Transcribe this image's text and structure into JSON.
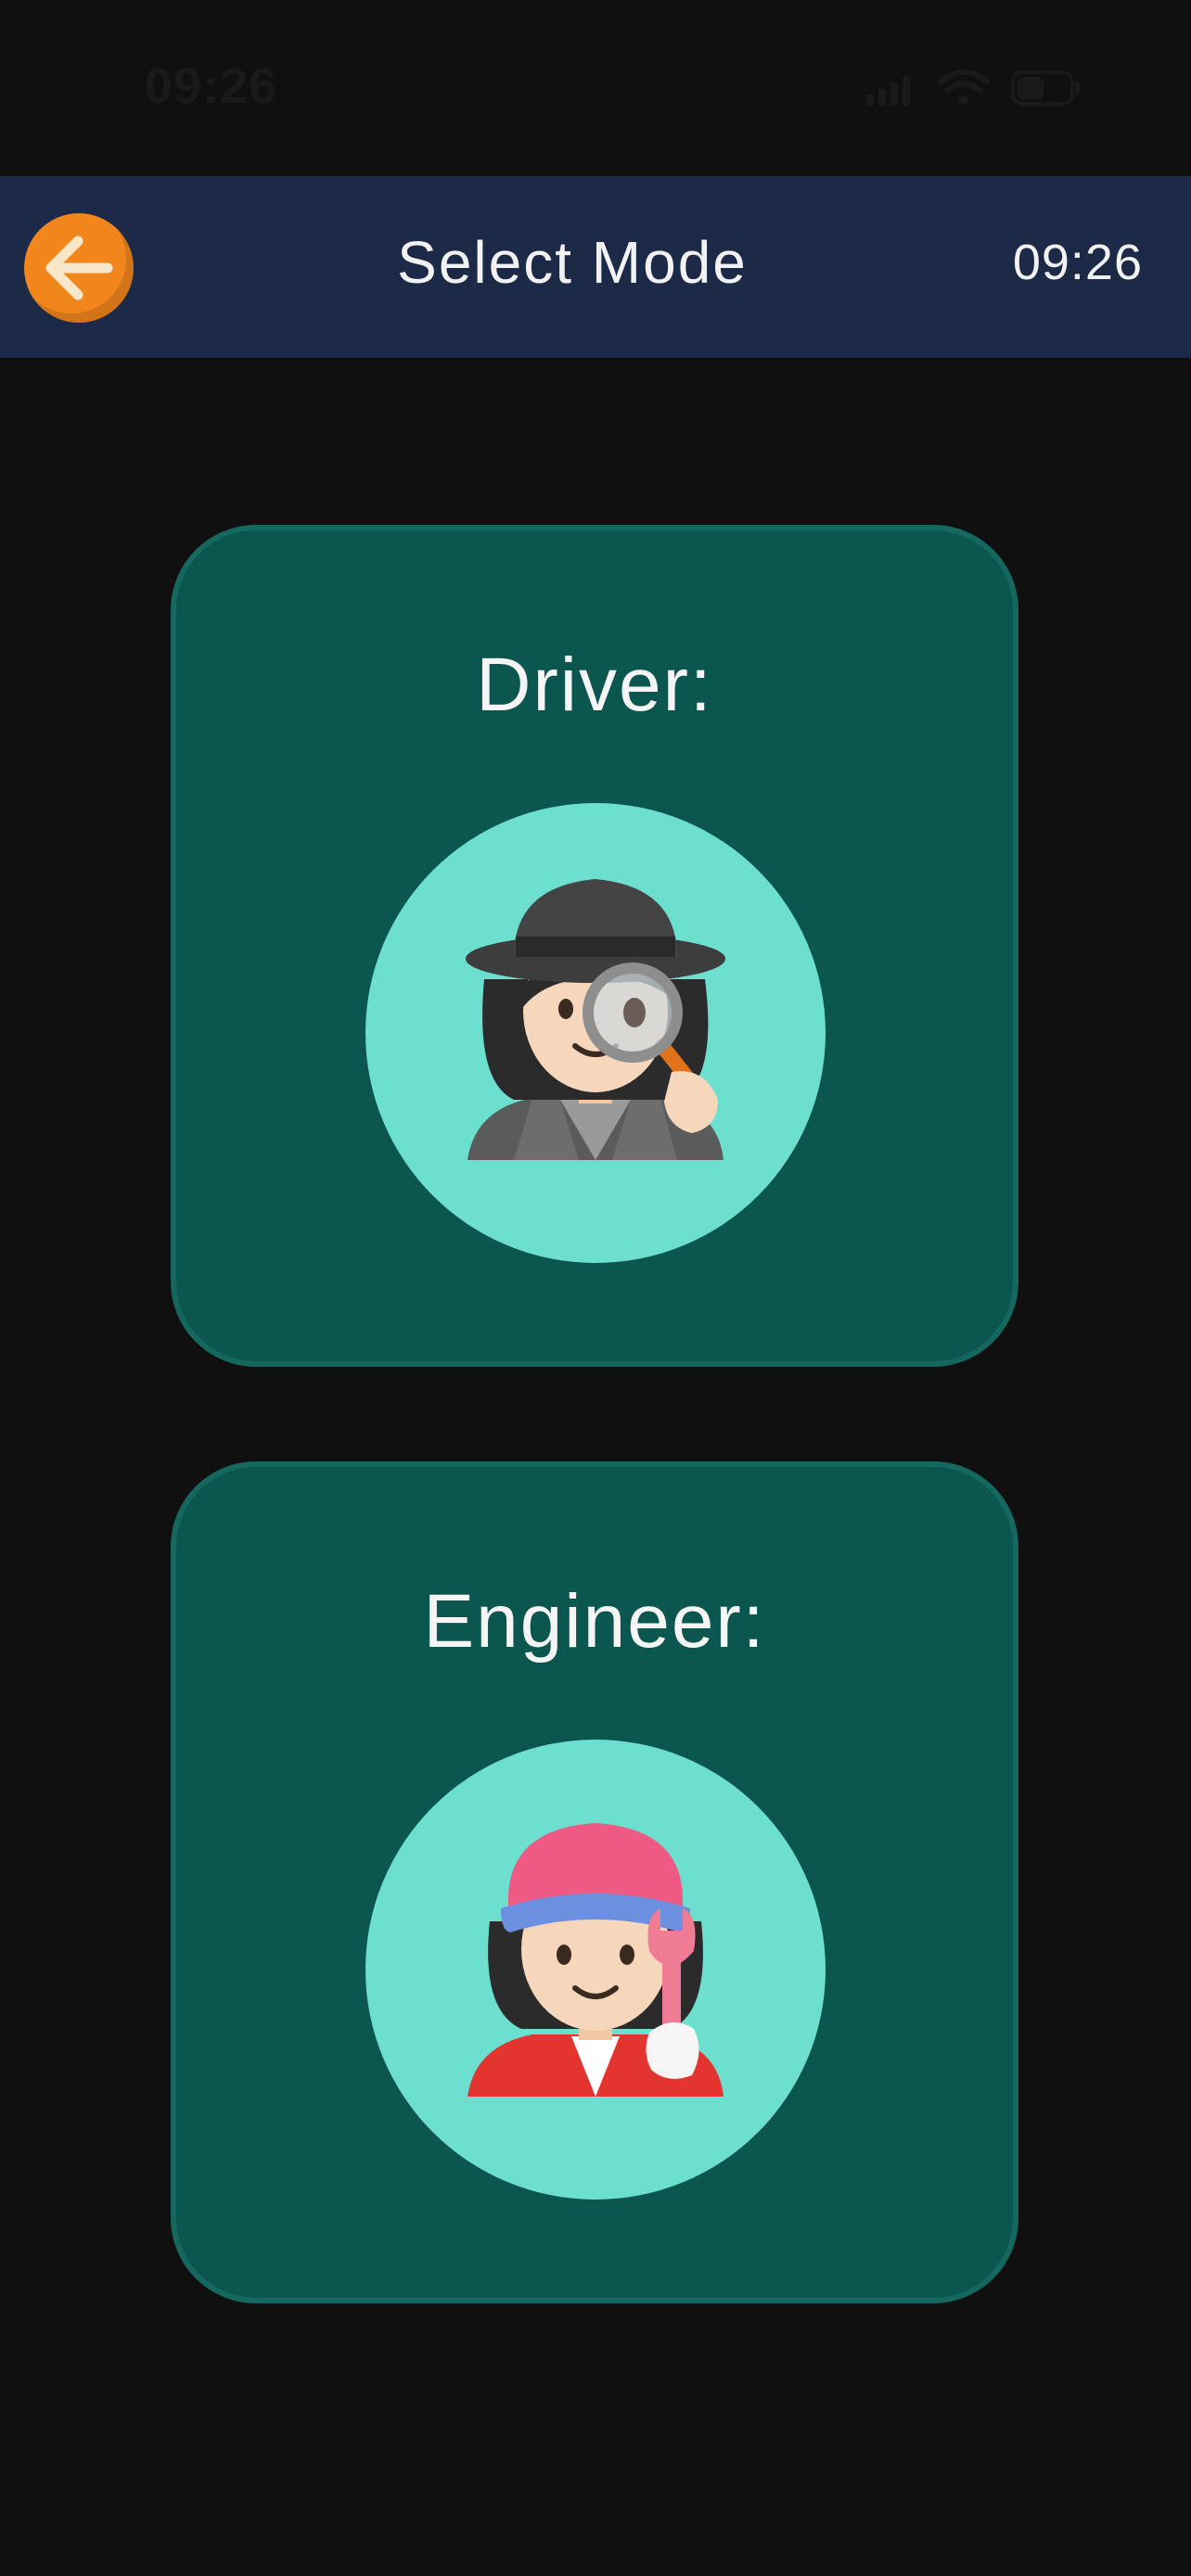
{
  "status_bar": {
    "time": "09:26",
    "icons": [
      "signal-icon",
      "wifi-icon",
      "battery-icon"
    ]
  },
  "header": {
    "back_icon": "back-arrow-icon",
    "title": "Select Mode",
    "time": "09:26",
    "background": "#1c2a48",
    "back_color": "#f0861c"
  },
  "modes": [
    {
      "label": "Driver:",
      "icon": "detective-icon"
    },
    {
      "label": "Engineer:",
      "icon": "mechanic-icon"
    }
  ],
  "colors": {
    "page_background": "#101010",
    "card_background": "#0b564e",
    "card_border": "#14685e",
    "avatar_background": "#6ddfcf"
  }
}
